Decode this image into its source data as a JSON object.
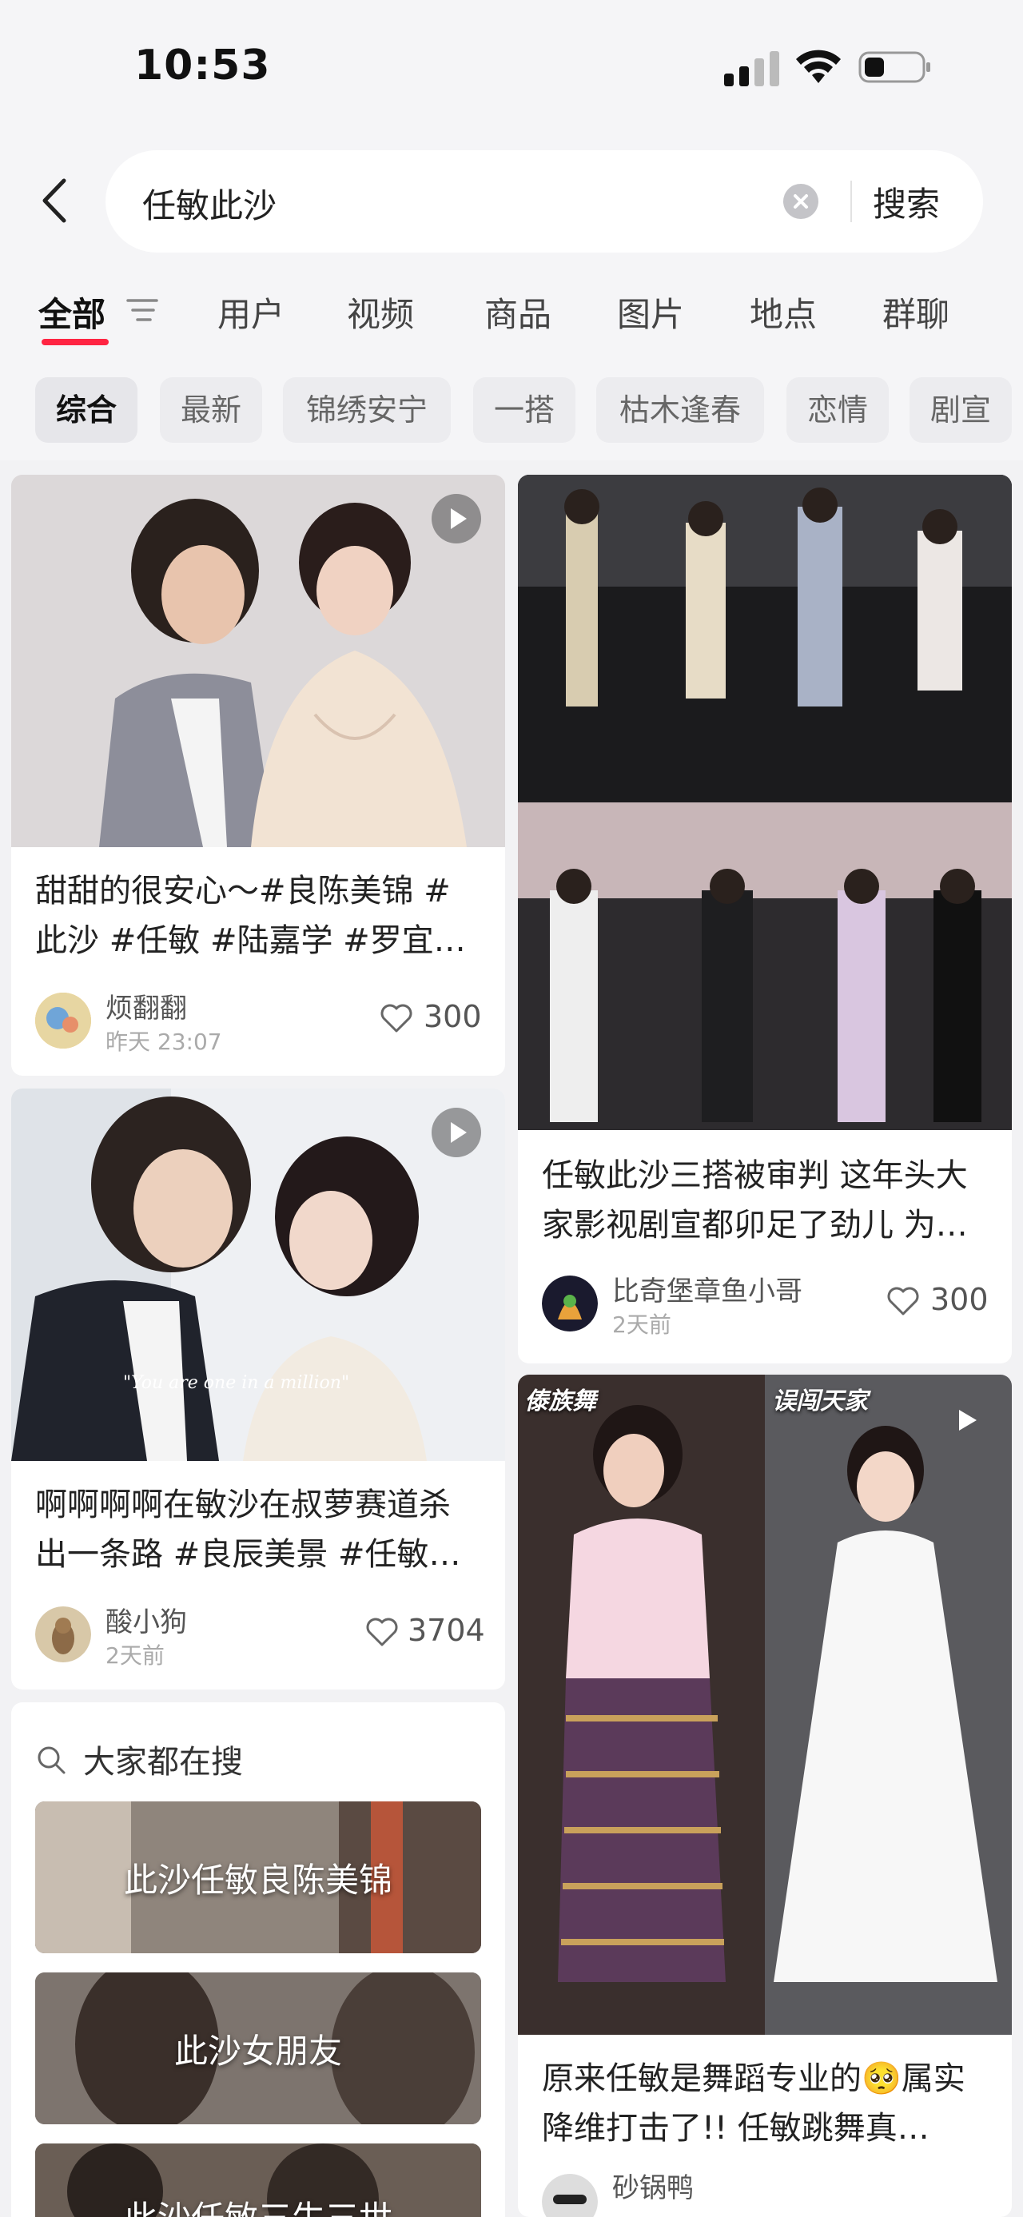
{
  "status": {
    "time": "10:53"
  },
  "search": {
    "query": "任敏此沙",
    "button_label": "搜索"
  },
  "tabs": [
    "全部",
    "用户",
    "视频",
    "商品",
    "图片",
    "地点",
    "群聊"
  ],
  "chips": [
    "综合",
    "最新",
    "锦绣安宁",
    "一搭",
    "枯木逢春",
    "恋情",
    "剧宣"
  ],
  "cards": [
    {
      "title_line1": "甜甜的很安心～#良陈美锦 #",
      "title_line2": "此沙 #任敏 #陆嘉学 #罗宜…",
      "author": "烦翻翻",
      "time": "昨天 23:07",
      "likes": "300"
    },
    {
      "title_line1": "任敏此沙三搭被审判 这年头大",
      "title_line2": "家影视剧宣都卯足了劲儿 为…",
      "author": "比奇堡章鱼小哥",
      "time": "2天前",
      "likes": "300"
    },
    {
      "title_line1": "啊啊啊啊在敏沙在叔萝赛道杀",
      "title_line2": "出一条路 #良辰美景 #任敏…",
      "author": "酸小狗",
      "time": "2天前",
      "likes": "3704",
      "image_quote": "\"You are one in a million\""
    },
    {
      "title_line1": "原来任敏是舞蹈专业的🥺属实",
      "title_line2": "降维打击了!!  任敏跳舞真…",
      "author": "砂锅鸭",
      "image_labels": [
        "傣族舞",
        "误闯天家"
      ]
    }
  ],
  "popular": {
    "title": "大家都在搜",
    "items": [
      "此沙任敏良陈美锦",
      "此沙女朋友",
      "此沙任敏三生三世"
    ]
  },
  "colors": {
    "accent": "#ff2442",
    "background": "#f5f5f7",
    "card": "#ffffff"
  }
}
